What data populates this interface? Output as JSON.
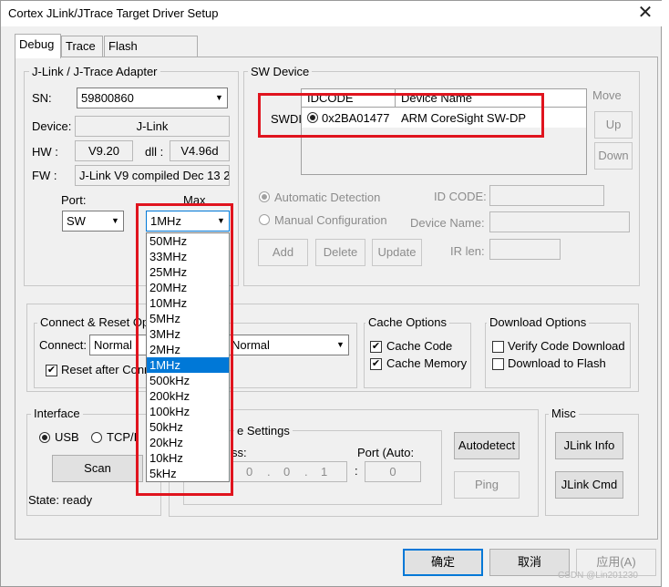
{
  "window": {
    "title": "Cortex JLink/JTrace Target Driver Setup"
  },
  "tabs": [
    {
      "label": "Debug"
    },
    {
      "label": "Trace"
    },
    {
      "label": "Flash Download"
    }
  ],
  "adapter": {
    "legend": "J-Link / J-Trace Adapter",
    "sn_label": "SN:",
    "sn_value": "59800860",
    "device_label": "Device:",
    "device_value": "J-Link",
    "hw_label": "HW :",
    "hw_value": "V9.20",
    "dll_label": "dll :",
    "dll_value": "V4.96d",
    "fw_label": "FW :",
    "fw_value": "J-Link V9 compiled Dec 13 2",
    "port_label": "Port:",
    "port_value": "SW",
    "max_label": "Max",
    "max_value": "1MHz"
  },
  "max_options": [
    "50MHz",
    "33MHz",
    "25MHz",
    "20MHz",
    "10MHz",
    "5MHz",
    "3MHz",
    "2MHz",
    "1MHz",
    "500kHz",
    "200kHz",
    "100kHz",
    "50kHz",
    "20kHz",
    "10kHz",
    "5kHz"
  ],
  "max_selected_index": 8,
  "sw_device": {
    "legend": "SW Device",
    "col_idcode": "IDCODE",
    "col_name": "Device Name",
    "row_label": "SWDI",
    "row_idcode": "0x2BA01477",
    "row_name": "ARM CoreSight SW-DP",
    "move_label": "Move",
    "up": "Up",
    "down": "Down",
    "auto_detect": "Automatic Detection",
    "manual_config": "Manual Configuration",
    "id_code_label": "ID CODE:",
    "device_name_label": "Device Name:",
    "ir_len_label": "IR len:",
    "add": "Add",
    "delete": "Delete",
    "update": "Update"
  },
  "connect_reset": {
    "legend": "Connect & Reset Op",
    "connect_label": "Connect:",
    "connect_value": "Normal",
    "reset_value": "Normal",
    "reset_after_connect": "Reset after Conn"
  },
  "cache": {
    "legend": "Cache Options",
    "code": "Cache Code",
    "memory": "Cache Memory"
  },
  "download": {
    "legend": "Download Options",
    "verify": "Verify Code Download",
    "flash": "Download to Flash"
  },
  "interface": {
    "legend": "Interface",
    "usb": "USB",
    "tcpip": "TCP/I",
    "scan": "Scan",
    "state": "State: ready"
  },
  "tcpip_settings": {
    "legend": "e Settings",
    "address_label": "ss:",
    "address_parts": [
      "0",
      "0",
      "1"
    ],
    "colon": ":",
    "port_label": "Port (Auto:",
    "port_value": "0",
    "autodetect": "Autodetect",
    "ping": "Ping"
  },
  "misc": {
    "legend": "Misc",
    "jlink_info": "JLink Info",
    "jlink_cmd": "JLink Cmd"
  },
  "footer": {
    "ok": "确定",
    "cancel": "取消",
    "apply": "应用(A)"
  },
  "watermark": "CSDN @Lin201230",
  "colors": {
    "highlight": "#e0141e",
    "selection": "#0078d7"
  }
}
